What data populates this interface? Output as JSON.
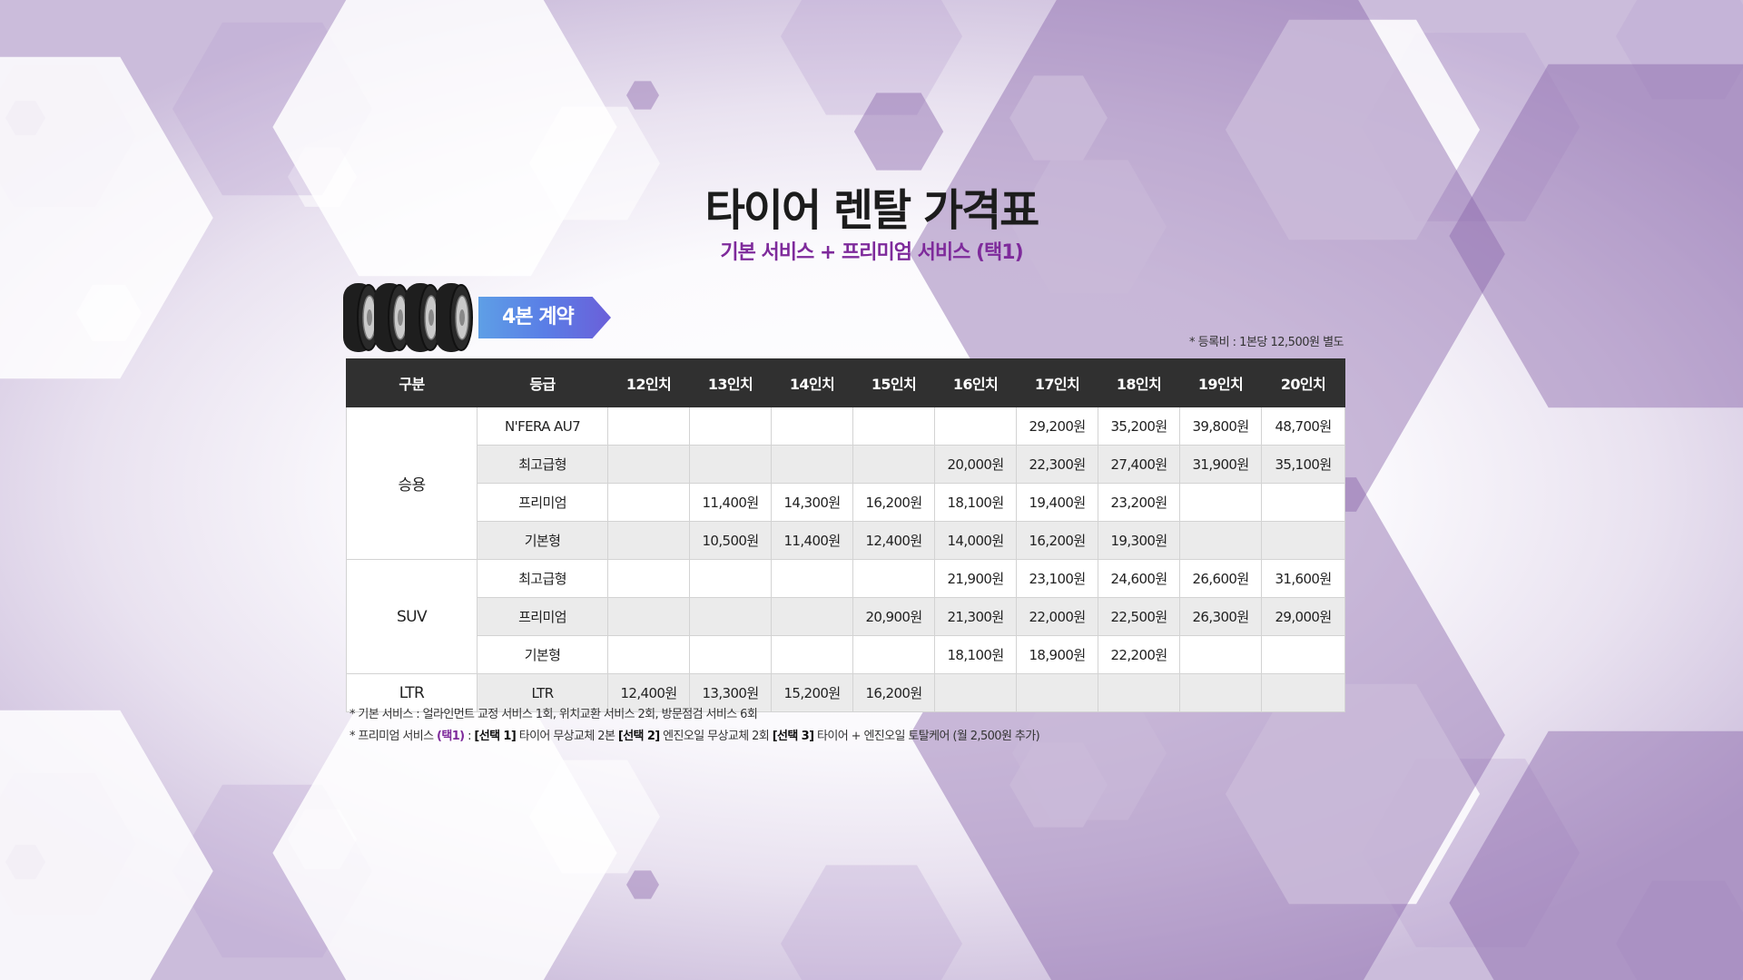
{
  "header": {
    "title": "타이어 렌탈 가격표",
    "subtitle": "기본 서비스 + 프리미엄 서비스 (택1)",
    "badge": "4본 계약",
    "registration_note": "* 등록비 : 1본당 12,500원 별도"
  },
  "table": {
    "headers": [
      "구분",
      "등급",
      "12인치",
      "13인치",
      "14인치",
      "15인치",
      "16인치",
      "17인치",
      "18인치",
      "19인치",
      "20인치"
    ],
    "groups": [
      {
        "category": "승용",
        "rows": [
          {
            "grade": "N'FERA AU7",
            "prices": [
              "",
              "",
              "",
              "",
              "",
              "29,200원",
              "35,200원",
              "39,800원",
              "48,700원"
            ]
          },
          {
            "grade": "최고급형",
            "prices": [
              "",
              "",
              "",
              "",
              "20,000원",
              "22,300원",
              "27,400원",
              "31,900원",
              "35,100원"
            ]
          },
          {
            "grade": "프리미엄",
            "prices": [
              "",
              "11,400원",
              "14,300원",
              "16,200원",
              "18,100원",
              "19,400원",
              "23,200원",
              "",
              ""
            ]
          },
          {
            "grade": "기본형",
            "prices": [
              "",
              "10,500원",
              "11,400원",
              "12,400원",
              "14,000원",
              "16,200원",
              "19,300원",
              "",
              ""
            ]
          }
        ]
      },
      {
        "category": "SUV",
        "rows": [
          {
            "grade": "최고급형",
            "prices": [
              "",
              "",
              "",
              "",
              "21,900원",
              "23,100원",
              "24,600원",
              "26,600원",
              "31,600원"
            ]
          },
          {
            "grade": "프리미엄",
            "prices": [
              "",
              "",
              "",
              "20,900원",
              "21,300원",
              "22,000원",
              "22,500원",
              "26,300원",
              "29,000원"
            ]
          },
          {
            "grade": "기본형",
            "prices": [
              "",
              "",
              "",
              "",
              "18,100원",
              "18,900원",
              "22,200원",
              "",
              ""
            ]
          }
        ]
      },
      {
        "category": "LTR",
        "rows": [
          {
            "grade": "LTR",
            "prices": [
              "12,400원",
              "13,300원",
              "15,200원",
              "16,200원",
              "",
              "",
              "",
              "",
              ""
            ]
          }
        ]
      }
    ]
  },
  "notes": {
    "basic_prefix": "* 기본 서비스 : ",
    "basic_text": "얼라인먼트 교정 서비스 1회, 위치교환 서비스 2회, 방문점검 서비스 6회",
    "premium_prefix": "* 프리미엄 서비스 ",
    "premium_tag": "(택1)",
    "premium_colon": " : ",
    "opt1_label": "[선택 1]",
    "opt1_text": " 타이어 무상교체 2본  ",
    "opt2_label": "[선택 2]",
    "opt2_text": " 엔진오일 무상교체 2회  ",
    "opt3_label": "[선택 3]",
    "opt3_text": " 타이어 + 엔진오일 토탈케어 (월 2,500원 추가)"
  },
  "colors": {
    "accent_purple": "#7e2a9b",
    "header_bg": "#303030",
    "badge_gradient_start": "#5e9fe6",
    "badge_gradient_end": "#6b5fd9"
  },
  "icons": [
    "tire-icon"
  ]
}
